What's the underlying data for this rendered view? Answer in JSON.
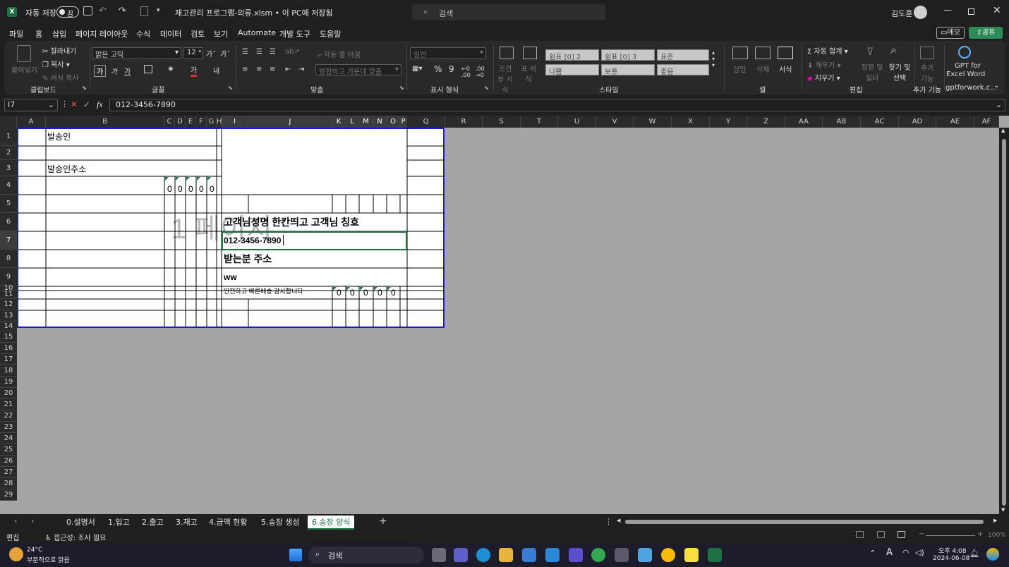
{
  "title": {
    "autosave_label": "자동 저장",
    "autosave_state": "끔",
    "document": "재고관리 프로그램-의류.xlsm • 이 PC에 저장됨",
    "search_placeholder": "검색",
    "user": "김도훈"
  },
  "menu": {
    "items": [
      "파일",
      "홈",
      "삽입",
      "페이지 레이아웃",
      "수식",
      "데이터",
      "검토",
      "보기",
      "Automate",
      "개발 도구",
      "도움말"
    ],
    "memo": "메모",
    "share": "공유"
  },
  "ribbon": {
    "clipboard": {
      "paste": "붙여넣기",
      "cut": "잘라내기",
      "copy": "복사",
      "format_painter": "서식 복사",
      "label": "클립보드"
    },
    "font": {
      "name": "맑은 고딕",
      "size": "12",
      "bold": "가",
      "italic": "가",
      "underline": "가",
      "label": "글꼴"
    },
    "align": {
      "wrap": "자동 줄 바꿈",
      "merge": "병합하고 가운데 맞춤",
      "label": "맞춤"
    },
    "number": {
      "format": "일반",
      "label": "표시 형식"
    },
    "styles": {
      "conditional": "조건부 서식",
      "table": "표 서식",
      "cells": [
        "쉼표 [0] 2",
        "쉼표 [0] 3",
        "표준",
        "나쁨",
        "보통",
        "좋음"
      ],
      "label": "스타일"
    },
    "cells": {
      "insert": "삽입",
      "delete": "삭제",
      "format": "서식",
      "label": "셀"
    },
    "editing": {
      "autosum": "자동 합계",
      "fill": "채우기",
      "clear": "지우기",
      "sort": "정렬 및 필터",
      "find": "찾기 및 선택",
      "label": "편집"
    },
    "addins": {
      "label": "추가 기능",
      "addin": "추가 기능"
    },
    "gpt": {
      "line1": "GPT for",
      "line2": "Excel Word",
      "label": "gptforwork.c..."
    }
  },
  "formula": {
    "namebox": "I7",
    "fx": "fx",
    "value": "012-3456-7890"
  },
  "columns": [
    "A",
    "B",
    "C",
    "D",
    "E",
    "F",
    "G",
    "H",
    "I",
    "J",
    "K",
    "L",
    "M",
    "N",
    "O",
    "P",
    "Q",
    "R",
    "S",
    "T",
    "U",
    "V",
    "W",
    "X",
    "Y",
    "Z",
    "AA",
    "AB",
    "AC",
    "AD",
    "AE",
    "AF"
  ],
  "rows": [
    "1",
    "2",
    "3",
    "4",
    "5",
    "6",
    "7",
    "8",
    "9",
    "10",
    "11",
    "12",
    "13",
    "14",
    "15",
    "16",
    "17",
    "18",
    "19",
    "20",
    "21",
    "22",
    "23",
    "24",
    "25",
    "26",
    "27",
    "28",
    "29"
  ],
  "cells": {
    "b1": "발송인",
    "b3": "발송인주소",
    "row4_zeros": [
      "0",
      "0",
      "0",
      "0",
      "0"
    ],
    "i6": "고객님성명 한칸띄고 고객님 칭호",
    "i7": "012-3456-7890",
    "i8": "받는분 주소",
    "i9": "ww",
    "i10": "안전하고 빠른배송 감사합니다",
    "row10_zeros": [
      "0",
      "0",
      "0",
      "0",
      "0"
    ],
    "watermark": "1 페이지"
  },
  "sheets": [
    "0.설명서",
    "1.입고",
    "2.출고",
    "3.재고",
    "4.금액 현황",
    "5.송장 생성",
    "6.송장 양식"
  ],
  "active_sheet_index": 6,
  "status": {
    "mode": "편집",
    "accessibility": "접근성: 조사 필요",
    "zoom": "100%"
  },
  "taskbar": {
    "weather_temp": "24°C",
    "weather_desc": "부분적으로 맑음",
    "search": "검색",
    "time": "오후 4:08",
    "date": "2024-06-08"
  }
}
